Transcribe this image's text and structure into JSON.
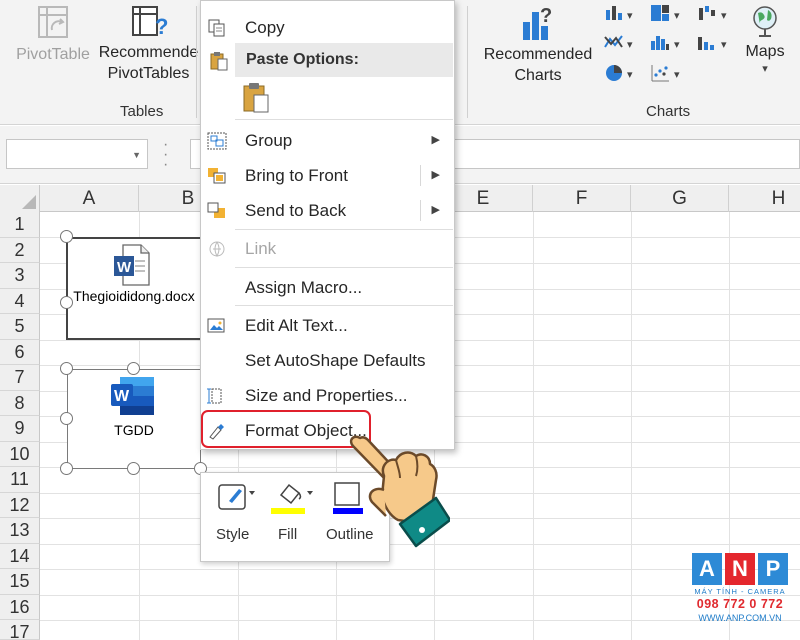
{
  "ribbon": {
    "pivottable": "PivotTable",
    "recommended_pivottables_line1": "Recommende",
    "recommended_pivottables_line2": "PivotTables",
    "tables_group": "Tables",
    "recommended_charts_line1": "Recommended",
    "recommended_charts_line2": "Charts",
    "maps": "Maps",
    "charts_group": "Charts"
  },
  "columns": [
    "A",
    "B",
    "E",
    "F",
    "G",
    "H"
  ],
  "rows": [
    "1",
    "2",
    "3",
    "4",
    "5",
    "6",
    "7",
    "8",
    "9",
    "10",
    "11",
    "12",
    "13",
    "14",
    "15",
    "16",
    "17"
  ],
  "objects": {
    "word_doc_label": "Thegioididong.docx",
    "tgdd_label": "TGDD"
  },
  "context_menu": {
    "copy": "Copy",
    "paste_options": "Paste Options:",
    "group": "Group",
    "bring_to_front": "Bring to Front",
    "send_to_back": "Send to Back",
    "link": "Link",
    "assign_macro": "Assign Macro...",
    "edit_alt_text": "Edit Alt Text...",
    "set_autoshape_defaults": "Set AutoShape Defaults",
    "size_and_properties": "Size and Properties...",
    "format_object": "Format Object..."
  },
  "mini_toolbar": {
    "style": "Style",
    "fill": "Fill",
    "outline": "Outline"
  },
  "watermark": {
    "letters": [
      "A",
      "N",
      "P"
    ],
    "tagline": "MÁY TÍNH - CAMERA",
    "phone": "098 772 0 772",
    "website": "WWW.ANP.COM.VN"
  },
  "colors": {
    "word_blue": "#2b5797",
    "highlight_red": "#e0202c",
    "fill_yellow": "#ffff00",
    "outline_blue": "#0000ff",
    "hand_skin": "#f6c98a",
    "sleeve_teal": "#0f8a86"
  }
}
